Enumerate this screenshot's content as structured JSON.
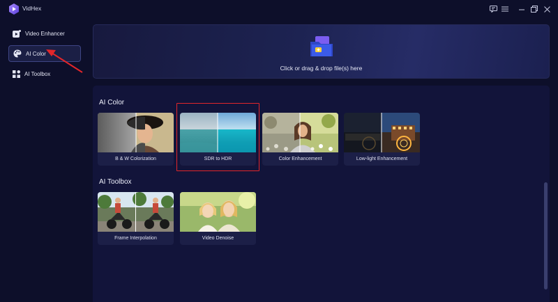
{
  "app": {
    "title": "VidHex"
  },
  "sidebar": {
    "items": [
      {
        "label": "Video Enhancer",
        "icon": "video-enhance-icon",
        "active": false
      },
      {
        "label": "AI Color",
        "icon": "palette-icon",
        "active": true
      },
      {
        "label": "AI Toolbox",
        "icon": "toolbox-grid-icon",
        "active": false
      }
    ]
  },
  "drop_zone": {
    "text": "Click or drag & drop file(s) here",
    "icon": "folder-add-icon"
  },
  "sections": [
    {
      "title": "AI Color",
      "cards": [
        {
          "label": "B & W Colorization"
        },
        {
          "label": "SDR to HDR",
          "highlighted": true
        },
        {
          "label": "Color Enhancement"
        },
        {
          "label": "Low-light Enhancement"
        }
      ]
    },
    {
      "title": "AI Toolbox",
      "cards": [
        {
          "label": "Frame Interpolation"
        },
        {
          "label": "Video Denoise"
        }
      ]
    }
  ],
  "window_controls": [
    "feedback-icon",
    "menu-icon",
    "minimize-icon",
    "restore-icon",
    "close-icon"
  ],
  "colors": {
    "background": "#0d0f2a",
    "panel": "#12143a",
    "accent": "#6b4bd6",
    "highlight": "#e3262a"
  }
}
